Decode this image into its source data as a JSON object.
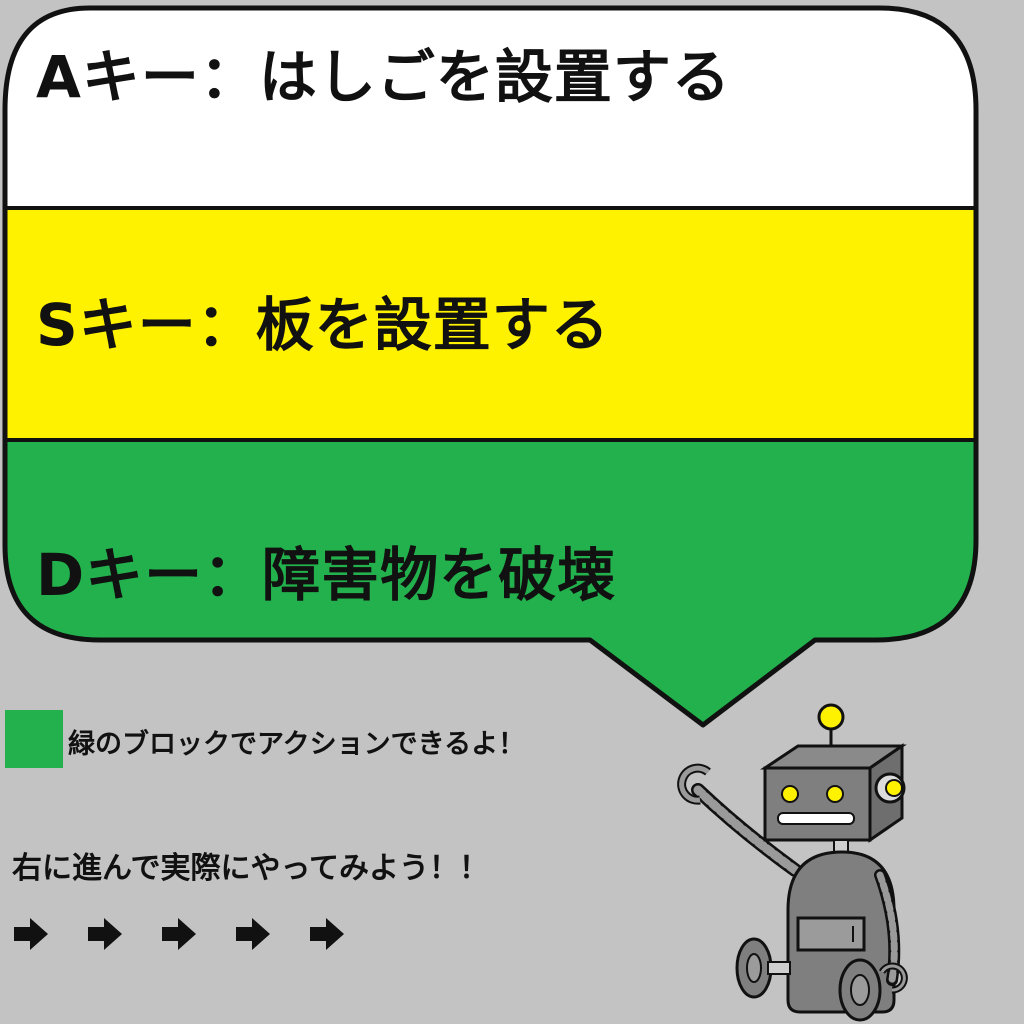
{
  "bubble": {
    "rows": [
      {
        "key": "A",
        "text": "Aキー：はしごを設置する",
        "color": "#ffffff"
      },
      {
        "key": "S",
        "text": "Sキー：板を設置する",
        "color": "#fff200"
      },
      {
        "key": "D",
        "text": "Dキー：障害物を破壊",
        "color": "#22b14c"
      }
    ],
    "outline_color": "#111111"
  },
  "legend": {
    "swatch_color": "#22b14c",
    "text": "緑のブロックでアクションできるよ！"
  },
  "prompt": {
    "text": "右に進んで実際にやってみよう！！"
  },
  "arrows": {
    "icon": "right-arrow-icon",
    "count": 5
  },
  "robot": {
    "icon": "robot-mascot-icon",
    "body_color": "#7f7f7f",
    "accent_color": "#fff200"
  },
  "background_color": "#c3c3c3"
}
